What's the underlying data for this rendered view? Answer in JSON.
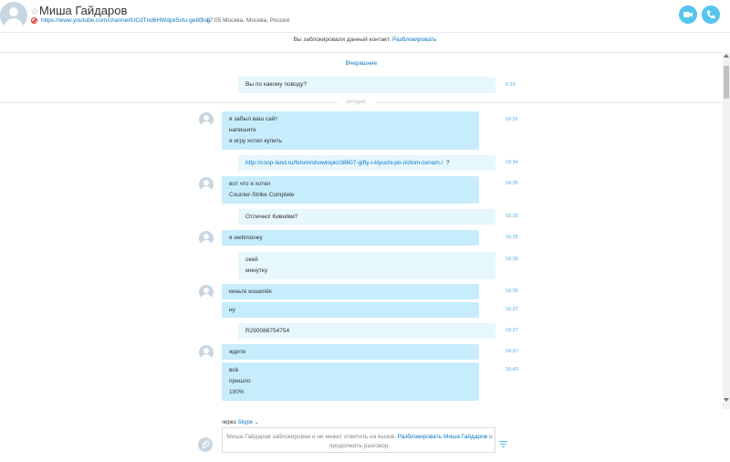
{
  "header": {
    "contact_name": "Миша Гайдаров",
    "star_glyph": "☆",
    "mood_link": "https://www.youtube.com/channel/UCdTnd6HWdpk5vtu-gebf3sg",
    "separator": "|",
    "local_info": "17:05 Москва, Москва, Россия",
    "accent_color": "#56c5ee"
  },
  "notice": {
    "text": "Вы заблокировали данный контакт.",
    "action": "Разблокировать"
  },
  "conversation": {
    "yesterday_label": "Вчерашние",
    "today_label": "сегодня",
    "messages": [
      {
        "dir": "out",
        "lines": [
          "Вы по какому поводу?"
        ],
        "time": "6:23"
      },
      {
        "dir": "in",
        "lines": [
          "я забыл ваш сайт",
          "напишите",
          "я игру хотел купить"
        ],
        "time": "16:31"
      },
      {
        "dir": "out",
        "lines": [
          "http://coop-land.ru/forum/showtopic/38607-gifty-i-klyuchi-po-nizkim-cenam./",
          "?"
        ],
        "time": "16:34"
      },
      {
        "dir": "in",
        "lines": [
          "вот что я хотел",
          "Counter-Strike Complete"
        ],
        "time": "16:35"
      },
      {
        "dir": "out",
        "lines": [
          "Отлично! Киви/вм?"
        ],
        "time": "16:35"
      },
      {
        "dir": "in",
        "lines": [
          "я webmoney"
        ],
        "time": "16:35"
      },
      {
        "dir": "out",
        "lines": [
          "окей",
          "минутку"
        ],
        "time": "16:36"
      },
      {
        "dir": "in",
        "lines": [
          "киньте кошелёк"
        ],
        "time": "16:36"
      },
      {
        "dir": "in",
        "lines": [
          "ну"
        ],
        "time": "16:37"
      },
      {
        "dir": "out",
        "lines": [
          "R290088754754"
        ],
        "time": "16:37"
      },
      {
        "dir": "in",
        "lines": [
          "ждите"
        ],
        "time": "16:37"
      },
      {
        "dir": "in",
        "lines": [
          "всё",
          "пришло",
          "100%"
        ],
        "time": "16:40"
      }
    ]
  },
  "composer": {
    "via_prefix": "через",
    "via_link": "Skype",
    "via_chevron": "⌄",
    "blocked_text_1": "Миша Гайдаров заблокирован и не может ответить на вызов.",
    "blocked_link": "Разблокировать Миша Гайдаров",
    "blocked_text_2": "и продолжить разговор."
  }
}
